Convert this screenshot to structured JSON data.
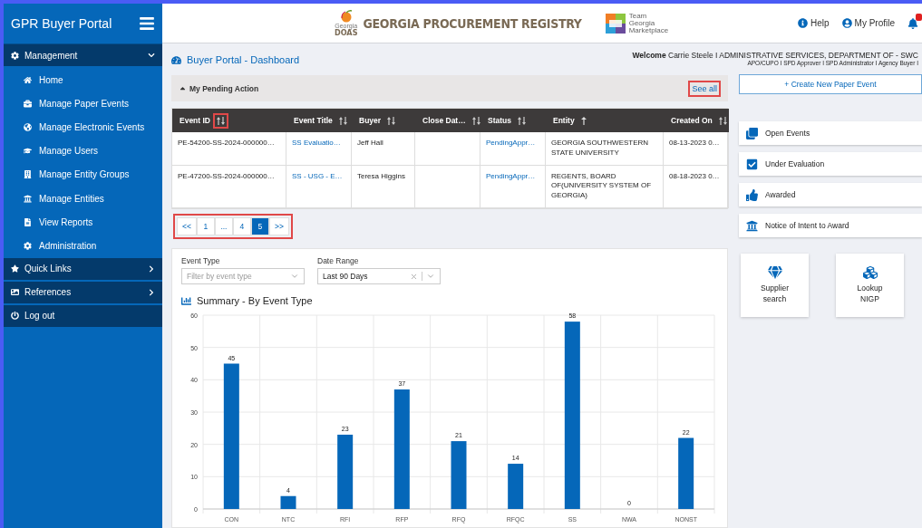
{
  "sidebar": {
    "title": "GPR Buyer Portal",
    "groups": [
      {
        "label": "Management",
        "expanded": true,
        "items": [
          {
            "label": "Home"
          },
          {
            "label": "Manage Paper Events"
          },
          {
            "label": "Manage Electronic Events"
          },
          {
            "label": "Manage Users"
          },
          {
            "label": "Manage Entity Groups"
          },
          {
            "label": "Manage Entities"
          },
          {
            "label": "View Reports"
          },
          {
            "label": "Administration"
          }
        ]
      },
      {
        "label": "Quick Links",
        "expanded": false
      },
      {
        "label": "References",
        "expanded": false
      },
      {
        "label": "Log out"
      }
    ]
  },
  "header": {
    "doas_logo": {
      "state": "Georgia",
      "name": "DOAS"
    },
    "registry_title": "GEORGIA PROCUREMENT REGISTRY",
    "marketplace_logo": [
      "Team",
      "Georgia",
      "Marketplace"
    ],
    "links": [
      "Help",
      "My Profile"
    ]
  },
  "page_title": "Buyer Portal - Dashboard",
  "welcome": {
    "line": "**Welcome** Carrie Steele I ADMINISTRATIVE SERVICES, DEPARTMENT OF - SWC",
    "roles": "APO/CUPO I SPD Approver I SPD Administrator I Agency Buyer I"
  },
  "pending": {
    "title": "My Pending Action",
    "expanded": true,
    "see_all": {
      "label": "See all",
      "highlighted": true
    },
    "columns": [
      {
        "label": "Event ID",
        "sorted_ascending": false,
        "highlighted": true
      },
      {
        "label": "Event Title",
        "sorted_ascending": false
      },
      {
        "label": "Buyer",
        "sorted_ascending": false
      },
      {
        "label": "Close Dat…",
        "sorted_ascending": false
      },
      {
        "label": "Status",
        "sorted_ascending": false
      },
      {
        "label": "Entity",
        "sorted_ascending": true
      },
      {
        "label": "Created On",
        "sorted_ascending": false
      }
    ],
    "rows": [
      [
        "PE-54200-SS-2024-000000…",
        "SS Evaluatio…",
        "Jeff Hall",
        "",
        "PendingAppr…",
        "GEORGIA SOUTHWESTERN STATE UNIVERSITY",
        "08-13-2023 0…"
      ],
      [
        "PE-47200-SS-2024-000000…",
        "SS - USG - E…",
        "Teresa Higgins",
        "",
        "PendingAppr…",
        "REGENTS, BOARD OF(UNIVERSITY SYSTEM OF GEORGIA)",
        "08-18-2023 0…"
      ]
    ],
    "pagination": {
      "highlighted": true,
      "pages": [
        {
          "label": "<<",
          "selected": false
        },
        {
          "label": "1",
          "selected": false
        },
        {
          "label": "...",
          "selected": false
        },
        {
          "label": "4",
          "selected": false
        },
        {
          "label": "5",
          "selected": true
        },
        {
          "label": ">>",
          "selected": false
        }
      ]
    }
  },
  "filters": [
    {
      "label": "Event Type",
      "placeholder": "Filter by event type"
    },
    {
      "label": "Date Range",
      "value": "Last 90 Days"
    }
  ],
  "summary": {
    "title": "Summary - By Event Type",
    "chart_data": {
      "type": "bar",
      "categories": [
        "CON",
        "NTC",
        "RFI",
        "RFP",
        "RFQ",
        "RFQC",
        "SS",
        "NWA",
        "NONST"
      ],
      "series": [
        {
          "color": "#0567b9",
          "values": [
            45,
            4,
            23,
            37,
            21,
            14,
            58,
            0,
            22
          ]
        }
      ],
      "ylim": [
        0,
        60
      ],
      "yticks": [
        0,
        10,
        20,
        30,
        40,
        50,
        60
      ],
      "data_labels": true,
      "grid": true
    }
  },
  "create_button": "+ Create New Paper Event",
  "status_cards": [
    "Open Events",
    "Under Evaluation",
    "Awarded",
    "Notice of Intent to Award"
  ],
  "tiles": [
    [
      "Supplier",
      "search"
    ],
    [
      "Lookup",
      "NIGP"
    ]
  ]
}
